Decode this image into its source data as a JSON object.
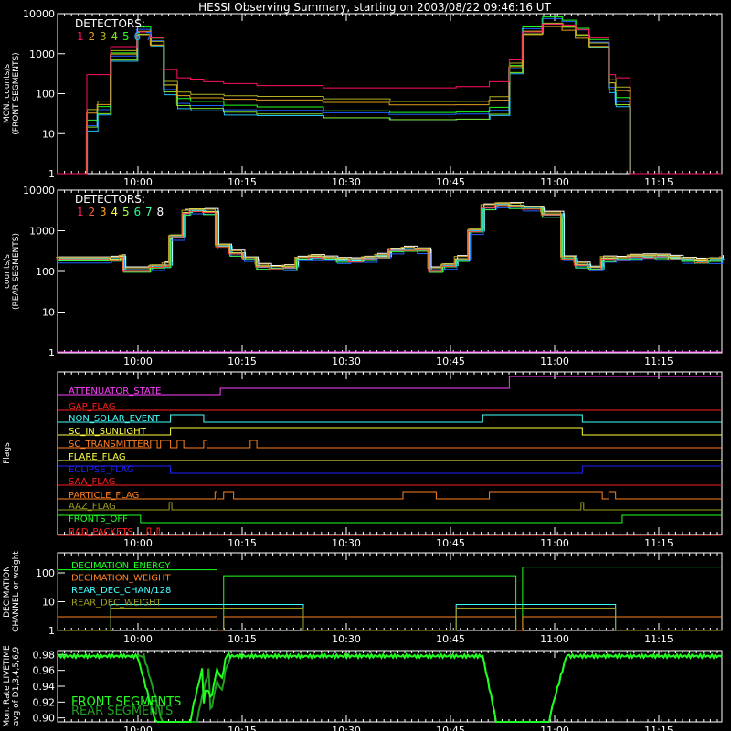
{
  "title": "HESSI Observing Summary, starting on 2003/08/22 09:46:16 UT",
  "colors": {
    "det": [
      "#ff0040",
      "#ff6040",
      "#ffa020",
      "#ffff40",
      "#80ff40",
      "#20ff80",
      "#40a0ff",
      "#ffffff"
    ],
    "panel1_det": [
      "#ff1060",
      "#e0a020",
      "#b0b020",
      "#80e020",
      "#20ff20",
      "#20c0ff",
      "#2060ff",
      "#ffffff"
    ]
  },
  "chart_data": [
    {
      "type": "line",
      "name": "panel-front",
      "ylabel": [
        "MON. counts/s",
        "(FRONT SEGMENTS)"
      ],
      "yscale": "log",
      "ylim": [
        1,
        10000
      ],
      "xlim_min": [
        0,
        100
      ],
      "x_ticks": [
        "10:00",
        "10:15",
        "10:30",
        "10:45",
        "11:00",
        "11:15"
      ],
      "y_ticks": [
        "1",
        "10",
        "100",
        "1000",
        "10000"
      ],
      "legend": {
        "title": "DETECTORS:",
        "labels": [
          "1",
          "2",
          "3",
          "4",
          "5",
          "6",
          "7"
        ]
      },
      "series": [
        {
          "name": "1",
          "x": [
            0,
            4.2,
            4.4,
            6,
            8,
            12,
            14,
            16,
            18,
            20,
            22,
            25,
            30,
            40,
            50,
            60,
            65,
            68,
            70,
            73,
            76,
            78,
            80,
            83,
            84,
            86,
            86.2,
            100
          ],
          "y": [
            1,
            1,
            300,
            300,
            1500,
            3500,
            2500,
            400,
            250,
            220,
            200,
            180,
            160,
            140,
            140,
            150,
            200,
            700,
            3500,
            5500,
            5200,
            4000,
            2500,
            300,
            250,
            250,
            1,
            1
          ]
        },
        {
          "name": "3",
          "x": [
            0,
            4.2,
            4.4,
            6,
            8,
            12,
            14,
            16,
            18,
            20,
            25,
            30,
            40,
            50,
            60,
            65,
            68,
            70,
            73,
            76,
            78,
            80,
            83,
            84,
            86,
            86.2,
            100
          ],
          "y": [
            1,
            1,
            40,
            60,
            1000,
            3000,
            1800,
            200,
            110,
            90,
            75,
            70,
            65,
            62,
            65,
            80,
            500,
            3000,
            5000,
            4500,
            3000,
            1800,
            200,
            120,
            120,
            1,
            1
          ]
        },
        {
          "name": "5",
          "x": [
            0,
            4.2,
            4.4,
            6,
            8,
            12,
            14,
            16,
            18,
            20,
            25,
            30,
            40,
            50,
            60,
            65,
            68,
            70,
            73,
            76,
            78,
            80,
            83,
            84,
            86,
            86.2,
            100
          ],
          "y": [
            1,
            1,
            20,
            40,
            800,
            3500,
            2000,
            150,
            70,
            55,
            40,
            35,
            30,
            30,
            32,
            40,
            400,
            3500,
            6500,
            6000,
            4000,
            2000,
            150,
            60,
            60,
            1,
            1
          ]
        },
        {
          "name": "7",
          "x": [
            0,
            4.2,
            4.4,
            6,
            8,
            12,
            14,
            16,
            18,
            20,
            25,
            30,
            40,
            50,
            60,
            65,
            68,
            70,
            73,
            76,
            78,
            80,
            83,
            84,
            86,
            86.2,
            100
          ],
          "y": [
            1,
            1,
            15,
            35,
            700,
            3200,
            1800,
            120,
            55,
            45,
            32,
            30,
            28,
            28,
            30,
            35,
            350,
            3300,
            6200,
            5800,
            3800,
            1800,
            120,
            50,
            50,
            1,
            1
          ]
        }
      ]
    },
    {
      "type": "line",
      "name": "panel-rear",
      "ylabel": [
        "counts/s",
        "(REAR SEGMENTS)"
      ],
      "yscale": "log",
      "ylim": [
        1,
        10000
      ],
      "x_ticks": [
        "10:00",
        "10:15",
        "10:30",
        "10:45",
        "11:00",
        "11:15"
      ],
      "y_ticks": [
        "1",
        "10",
        "100",
        "1000",
        "10000"
      ],
      "legend": {
        "title": "DETECTORS:",
        "labels": [
          "1",
          "2",
          "3",
          "4",
          "5",
          "6",
          "7",
          "8"
        ]
      },
      "series": [
        {
          "name": "1",
          "x": [
            0,
            8,
            9.5,
            10,
            14,
            16,
            17,
            19,
            20,
            22,
            24,
            26,
            28,
            30,
            32,
            34,
            36,
            38,
            40,
            42,
            44,
            46,
            48,
            50,
            52,
            54,
            56,
            58,
            60,
            62,
            64,
            66,
            68,
            70,
            73,
            76,
            78,
            80,
            82,
            84,
            86,
            88,
            90,
            92,
            94,
            96,
            98,
            100
          ],
          "y": [
            200,
            220,
            250,
            110,
            120,
            130,
            700,
            3000,
            3500,
            3000,
            400,
            250,
            200,
            140,
            140,
            130,
            200,
            200,
            200,
            200,
            210,
            220,
            230,
            300,
            330,
            350,
            120,
            150,
            200,
            900,
            3500,
            4500,
            4500,
            4000,
            2500,
            200,
            130,
            120,
            220,
            230,
            230,
            220,
            210,
            210,
            210,
            200,
            200,
            200
          ]
        },
        {
          "name": "8",
          "x": [
            0,
            100
          ],
          "y": [
            1,
            1
          ]
        }
      ]
    },
    {
      "type": "line",
      "name": "panel-flags",
      "ylabel": [
        "Flags"
      ],
      "x_ticks": [
        "10:00",
        "10:15",
        "10:30",
        "10:45",
        "11:00",
        "11:15"
      ],
      "flags": [
        {
          "label": "ATTENUATOR_STATE",
          "color": "#ff40ff"
        },
        {
          "label": "GAP_FLAG",
          "color": "#ff2020"
        },
        {
          "label": "NON_SOLAR_EVENT",
          "color": "#40ffff"
        },
        {
          "label": "SC_IN_SUNLIGHT",
          "color": "#ffff40"
        },
        {
          "label": "SC_TRANSMITTER",
          "color": "#ff8020"
        },
        {
          "label": "FLARE_FLAG",
          "color": "#ffff40"
        },
        {
          "label": "ECLIPSE_FLAG",
          "color": "#2020ff"
        },
        {
          "label": "SAA_FLAG",
          "color": "#ff2020"
        },
        {
          "label": "PARTICLE_FLAG",
          "color": "#ff8020"
        },
        {
          "label": "AAZ_FLAG",
          "color": "#a0a020"
        },
        {
          "label": "FRONTS_OFF",
          "color": "#20ff20"
        },
        {
          "label": "BAD_PACKETS",
          "color": "#ff2020"
        }
      ]
    },
    {
      "type": "line",
      "name": "panel-decimation",
      "ylabel": [
        "DECIMATION",
        "CHANNEL or weight"
      ],
      "yscale": "log",
      "ylim": [
        1,
        500
      ],
      "x_ticks": [
        "10:00",
        "10:15",
        "10:30",
        "10:45",
        "11:00",
        "11:15"
      ],
      "y_ticks": [
        "1",
        "10",
        "100"
      ],
      "legend": {
        "labels": [
          "DECIMATION_ENERGY",
          "DECIMATION_WEIGHT",
          "REAR_DEC_CHAN/128",
          "REAR_DEC_WEIGHT"
        ]
      }
    },
    {
      "type": "line",
      "name": "panel-livetime",
      "ylabel": [
        "Mon. Rate LIVETIME",
        "avg of D1,3,4,5,6,9"
      ],
      "ylim": [
        0.895,
        0.985
      ],
      "x_ticks": [
        "10:00",
        "10:15",
        "10:30",
        "10:45",
        "11:00",
        "11:15"
      ],
      "y_ticks": [
        "0.90",
        "0.92",
        "0.94",
        "0.96",
        "0.98"
      ],
      "legend": {
        "labels": [
          "FRONT SEGMENTS",
          "REAR SEGMENTS"
        ]
      }
    }
  ]
}
